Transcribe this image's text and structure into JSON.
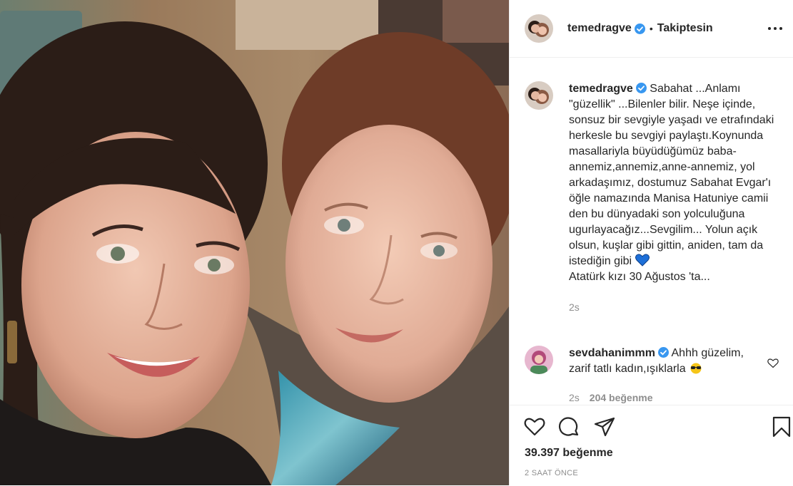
{
  "post": {
    "username": "temedragve",
    "follow_status": "Takiptesin",
    "caption": "Sabahat ...Anlamı \"güzellik\" ...Bilenler bilir. Neşe içinde, sonsuz bir sevgiyle yaşadı ve etrafındaki herkesle bu sevgiyi paylaştı.Koynunda masallariyla büyüdüğümüz baba-annemiz,annemiz,anne-annemiz, yol arkadaşımız, dostumuz Sabahat Evgar'ı öğle namazında Manisa Hatuniye camii den bu dünyadaki son yolculuğuna ugurlayacağız...Sevgilim... Yolun açık olsun, kuşlar gibi gittin, aniden, tam da istediğin gibi",
    "caption_tail": "Atatürk kızı 30 Ağustos 'ta...",
    "caption_time": "2s",
    "likes": "39.397 beğenme",
    "posted_ago": "2 SAAT ÖNCE"
  },
  "comment": {
    "username": "sevdahanimmm",
    "text": "Ahhh güzelim, zarif tatlı kadın,ışıklarla",
    "time": "2s",
    "likes": "204 beğenme"
  },
  "icons": {
    "header": [
      "verified-badge-icon",
      "more-options-icon"
    ],
    "caption": [
      "blue-heart-emoji-icon"
    ],
    "comment": [
      "sunglasses-emoji-icon",
      "comment-like-heart-icon"
    ],
    "actions": [
      "like-heart-icon",
      "comment-bubble-icon",
      "share-plane-icon",
      "save-bookmark-icon"
    ]
  },
  "colors": {
    "verified": "#3897f0",
    "text": "#262626",
    "muted": "#8e8e8e",
    "divider": "#efefef"
  }
}
